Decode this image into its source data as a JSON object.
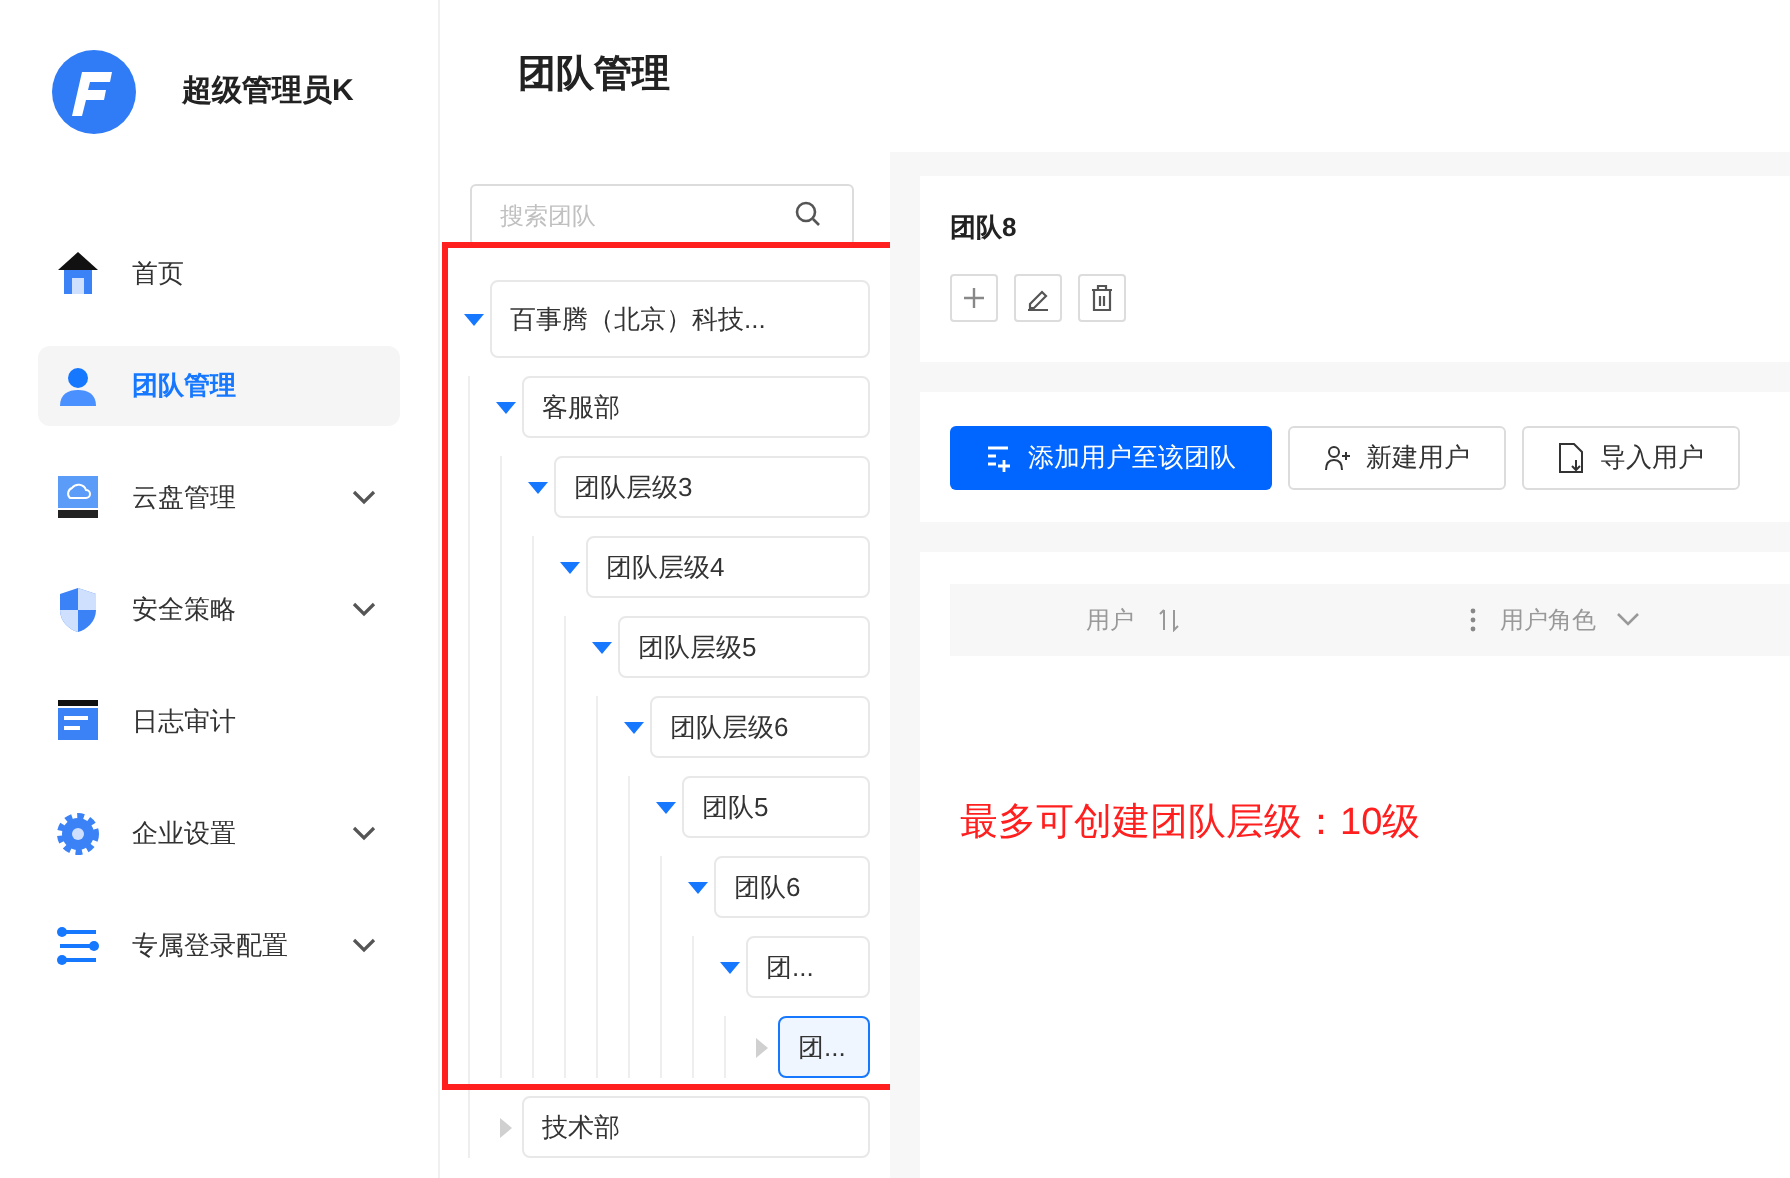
{
  "app": {
    "user_name": "超级管理员K"
  },
  "sidebar": {
    "items": [
      {
        "label": "首页",
        "selected": false,
        "has_submenu": false
      },
      {
        "label": "团队管理",
        "selected": true,
        "has_submenu": false
      },
      {
        "label": "云盘管理",
        "selected": false,
        "has_submenu": true
      },
      {
        "label": "安全策略",
        "selected": false,
        "has_submenu": true
      },
      {
        "label": "日志审计",
        "selected": false,
        "has_submenu": false
      },
      {
        "label": "企业设置",
        "selected": false,
        "has_submenu": true
      },
      {
        "label": "专属登录配置",
        "selected": false,
        "has_submenu": true
      }
    ]
  },
  "page_title": "团队管理",
  "tree_search": {
    "placeholder": "搜索团队"
  },
  "tree": [
    {
      "label": "百事腾（北京）科技...",
      "expanded": true,
      "selected": false,
      "children": [
        {
          "label": "客服部",
          "expanded": true,
          "selected": false,
          "children": [
            {
              "label": "团队层级3",
              "expanded": true,
              "selected": false,
              "children": [
                {
                  "label": "团队层级4",
                  "expanded": true,
                  "selected": false,
                  "children": [
                    {
                      "label": "团队层级5",
                      "expanded": true,
                      "selected": false,
                      "children": [
                        {
                          "label": "团队层级6",
                          "expanded": true,
                          "selected": false,
                          "children": [
                            {
                              "label": "团队5",
                              "expanded": true,
                              "selected": false,
                              "children": [
                                {
                                  "label": "团队6",
                                  "expanded": true,
                                  "selected": false,
                                  "children": [
                                    {
                                      "label": "团...",
                                      "expanded": true,
                                      "selected": false,
                                      "children": [
                                        {
                                          "label": "团...",
                                          "expanded": false,
                                          "selected": true
                                        }
                                      ]
                                    }
                                  ]
                                }
                              ]
                            }
                          ]
                        }
                      ]
                    }
                  ]
                }
              ]
            }
          ]
        },
        {
          "label": "技术部",
          "expanded": false,
          "selected": false
        }
      ]
    }
  ],
  "annotation": "最多可创建团队层级：10级",
  "team_card": {
    "title": "团队8"
  },
  "actions": [
    "添加用户至该团队",
    "新建用户",
    "导入用户"
  ],
  "table": {
    "columns": [
      "用户",
      "用户角色"
    ]
  }
}
